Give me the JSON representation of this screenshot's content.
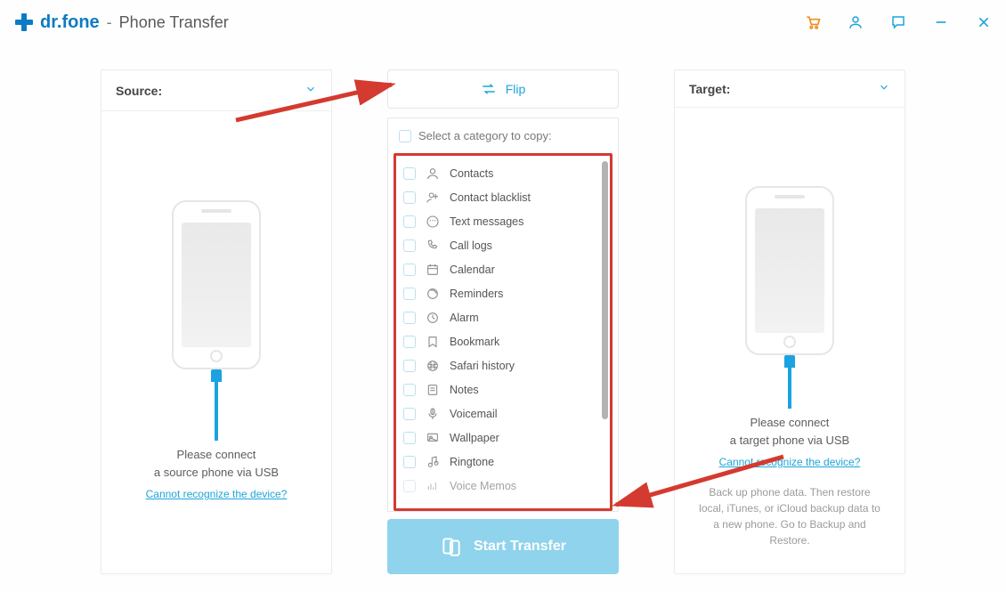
{
  "app": {
    "brand": "dr.fone",
    "page": "Phone Transfer"
  },
  "panels": {
    "source": {
      "label": "Source:",
      "msg_line1": "Please connect",
      "msg_line2": "a source phone via USB",
      "help": "Cannot recognize the device?"
    },
    "target": {
      "label": "Target:",
      "msg_line1": "Please connect",
      "msg_line2": "a target phone via USB",
      "help": "Cannot recognize the device?",
      "note": "Back up phone data. Then restore local, iTunes, or iCloud backup data to a new phone. Go to Backup and Restore."
    }
  },
  "center": {
    "flip": "Flip",
    "select_label": "Select a category to copy:",
    "start": "Start Transfer",
    "categories": [
      "Contacts",
      "Contact blacklist",
      "Text messages",
      "Call logs",
      "Calendar",
      "Reminders",
      "Alarm",
      "Bookmark",
      "Safari history",
      "Notes",
      "Voicemail",
      "Wallpaper",
      "Ringtone",
      "Voice Memos"
    ]
  }
}
